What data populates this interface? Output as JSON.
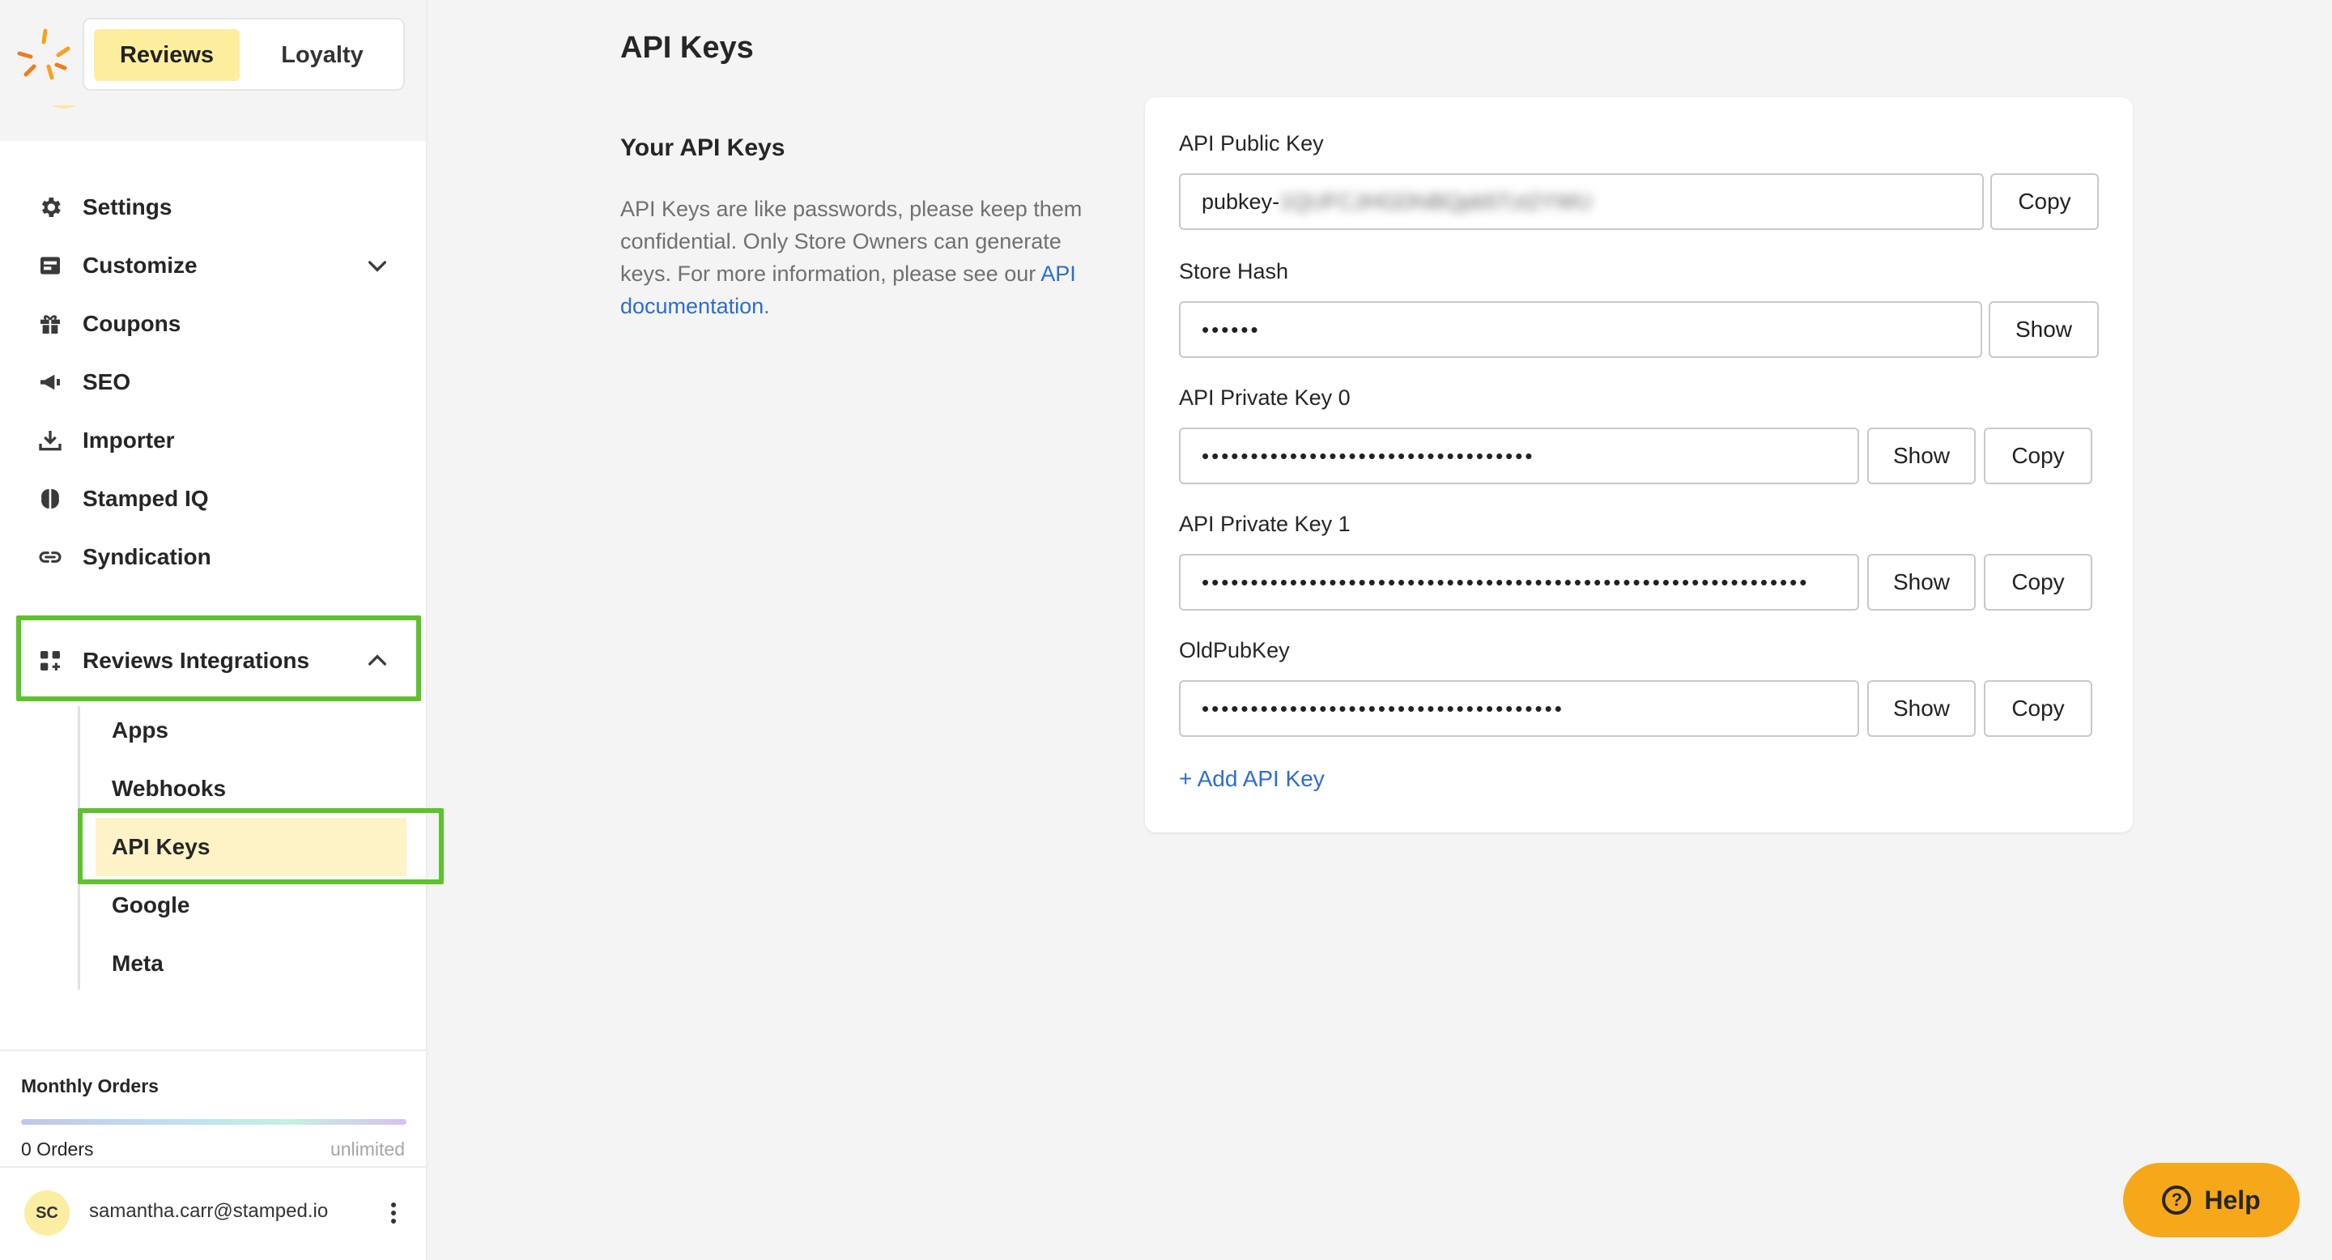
{
  "brand_tabs": {
    "active": "Reviews",
    "inactive": "Loyalty"
  },
  "sidebar": {
    "items": [
      {
        "label": "Settings",
        "icon": "gear-icon"
      },
      {
        "label": "Customize",
        "icon": "customize-icon"
      },
      {
        "label": "Coupons",
        "icon": "gift-icon"
      },
      {
        "label": "SEO",
        "icon": "megaphone-icon"
      },
      {
        "label": "Importer",
        "icon": "download-icon"
      },
      {
        "label": "Stamped IQ",
        "icon": "brain-icon"
      },
      {
        "label": "Syndication",
        "icon": "link-icon"
      }
    ],
    "integrations": {
      "label": "Reviews Integrations",
      "icon": "apps-grid-icon",
      "subitems": [
        "Apps",
        "Webhooks",
        "API Keys",
        "Google",
        "Meta"
      ],
      "active": "API Keys"
    },
    "orders": {
      "title": "Monthly Orders",
      "count": "0 Orders",
      "limit": "unlimited"
    },
    "user": {
      "initials": "SC",
      "email": "samantha.carr@stamped.io"
    }
  },
  "main": {
    "title": "API Keys",
    "section_title": "Your API Keys",
    "description": "API Keys are like passwords, please keep them confidential. Only Store Owners can generate keys. For more information, please see our ",
    "doc_link": "API documentation",
    "description_end": "."
  },
  "keys": {
    "public": {
      "label": "API Public Key",
      "value_prefix": "pubkey-",
      "value_rest": "1QUFCJHGDhiBQpb5Tzt2YWU",
      "copy": "Copy"
    },
    "store_hash": {
      "label": "Store Hash",
      "value": "••••••",
      "show": "Show"
    },
    "private0": {
      "label": "API Private Key 0",
      "value": "••••••••••••••••••••••••••••••••••",
      "show": "Show",
      "copy": "Copy"
    },
    "private1": {
      "label": "API Private Key 1",
      "value": "••••••••••••••••••••••••••••••••••••••••••••••••••••••••••••••",
      "show": "Show",
      "copy": "Copy"
    },
    "oldpub": {
      "label": "OldPubKey",
      "value": "•••••••••••••••••••••••••••••••••••••",
      "show": "Show",
      "copy": "Copy"
    },
    "add": "+ Add API Key"
  },
  "help": {
    "label": "Help"
  },
  "colors": {
    "highlight": "#5ec22e",
    "accent_yellow": "#fcee9d",
    "help_orange": "#f6a81a",
    "link_blue": "#2c6ecb"
  }
}
